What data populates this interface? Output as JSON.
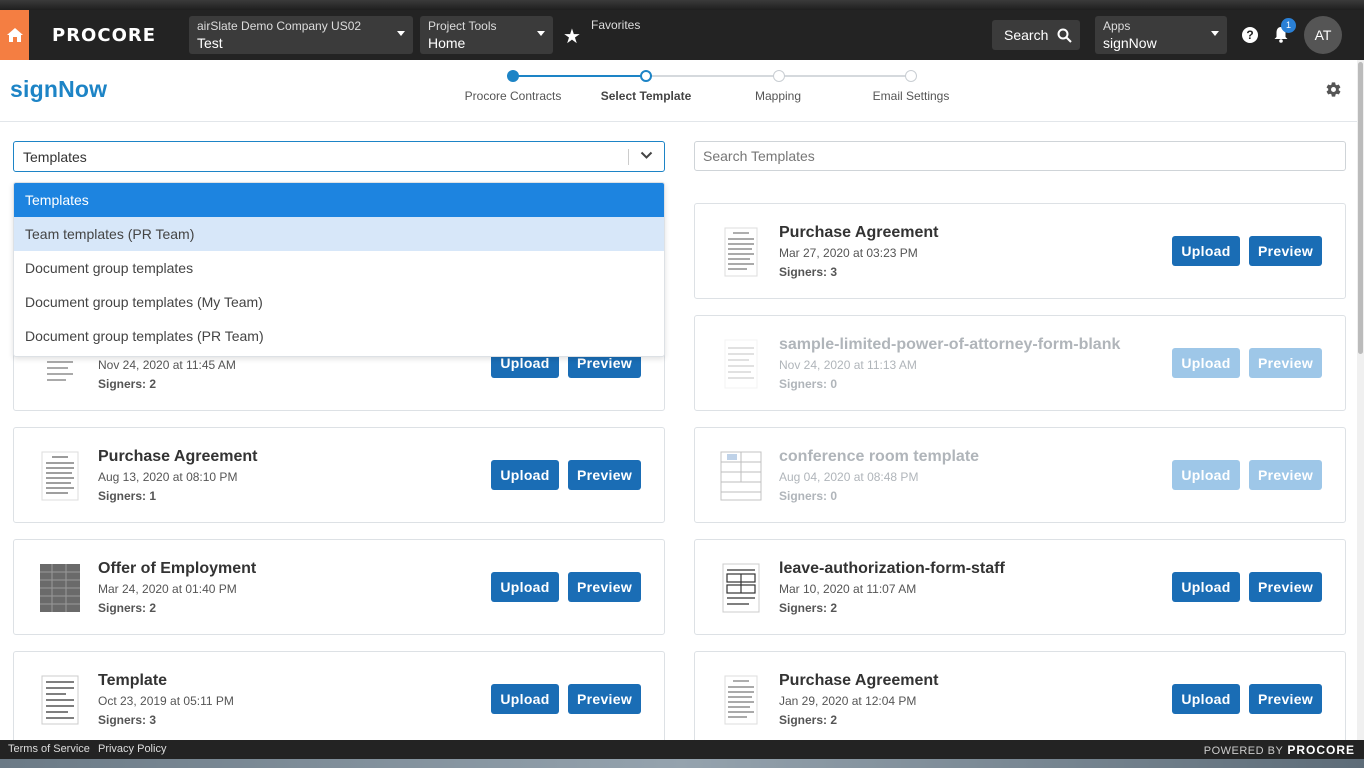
{
  "procore_header": {
    "logo": "PROCORE",
    "company_label": "airSlate Demo Company US02",
    "company_value": "Test",
    "tools_label": "Project Tools",
    "tools_value": "Home",
    "favorites": "Favorites",
    "search_label": "Search",
    "apps_label": "Apps",
    "apps_value": "signNow",
    "notification_count": "1",
    "user_initials": "AT"
  },
  "signnow": {
    "logo": "signNow",
    "steps": [
      {
        "label": "Procore Contracts",
        "state": "done"
      },
      {
        "label": "Select Template",
        "state": "current"
      },
      {
        "label": "Mapping",
        "state": "todo"
      },
      {
        "label": "Email Settings",
        "state": "todo"
      }
    ]
  },
  "filters": {
    "type_value": "Templates",
    "search_placeholder": "Search Templates"
  },
  "dropdown": {
    "options": [
      "Templates",
      "Team templates (PR Team)",
      "Document group templates",
      "Document group templates (My Team)",
      "Document group templates (PR Team)"
    ],
    "selected_index": 0,
    "hover_index": 1
  },
  "buttons": {
    "upload": "Upload",
    "preview": "Preview"
  },
  "templates_left": [
    {
      "title": "",
      "date": "Nov 24, 2020 at 11:45 AM",
      "signers": "Signers: 2",
      "faded": false
    },
    {
      "title": "Purchase Agreement",
      "date": "Aug 13, 2020 at 08:10 PM",
      "signers": "Signers: 1",
      "faded": false
    },
    {
      "title": "Offer of Employment",
      "date": "Mar 24, 2020 at 01:40 PM",
      "signers": "Signers: 2",
      "faded": false
    },
    {
      "title": "Template",
      "date": "Oct 23, 2019 at 05:11 PM",
      "signers": "Signers: 3",
      "faded": false
    }
  ],
  "templates_right": [
    {
      "title": "Purchase Agreement",
      "date": "Mar 27, 2020 at 03:23 PM",
      "signers": "Signers: 3",
      "faded": false
    },
    {
      "title": "sample-limited-power-of-attorney-form-blank",
      "date": "Nov 24, 2020 at 11:13 AM",
      "signers": "Signers: 0",
      "faded": true
    },
    {
      "title": "conference room template",
      "date": "Aug 04, 2020 at 08:48 PM",
      "signers": "Signers: 0",
      "faded": true
    },
    {
      "title": "leave-authorization-form-staff",
      "date": "Mar 10, 2020 at 11:07 AM",
      "signers": "Signers: 2",
      "faded": false
    },
    {
      "title": "Purchase Agreement",
      "date": "Jan 29, 2020 at 12:04 PM",
      "signers": "Signers: 2",
      "faded": false
    }
  ],
  "footer": {
    "terms": "Terms of Service",
    "privacy": "Privacy Policy",
    "powered_by": "POWERED BY",
    "powered_brand": "PROCORE"
  },
  "colors": {
    "accent": "#1d84c6",
    "button": "#1a6db5",
    "home": "#f47e42",
    "header": "#232323"
  }
}
